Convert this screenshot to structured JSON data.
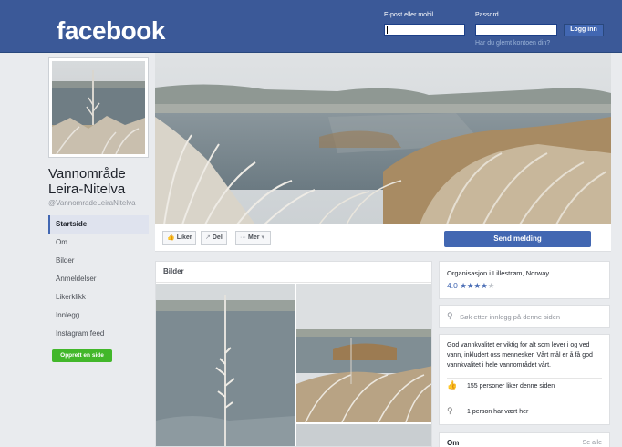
{
  "header": {
    "logo": "facebook",
    "email_label": "E-post eller mobil",
    "password_label": "Passord",
    "login_button": "Logg inn",
    "forgot_link": "Har du glemt kontoen din?",
    "brand_color": "#3b5998"
  },
  "page": {
    "name_line1": "Vannområde",
    "name_line2": "Leira-Nitelva",
    "handle": "@VannomradeLeiraNitelva"
  },
  "nav": {
    "items": [
      {
        "label": "Startside",
        "active": true
      },
      {
        "label": "Om",
        "active": false
      },
      {
        "label": "Bilder",
        "active": false
      },
      {
        "label": "Anmeldelser",
        "active": false
      },
      {
        "label": "Likerklikk",
        "active": false
      },
      {
        "label": "Innlegg",
        "active": false
      },
      {
        "label": "Instagram feed",
        "active": false
      }
    ],
    "create_page_button": "Opprett en side"
  },
  "actions": {
    "like": "Liker",
    "share": "Del",
    "more": "Mer",
    "send_message": "Send melding"
  },
  "photos": {
    "title": "Bilder"
  },
  "sidebar": {
    "org": "Organisasjon i Lillestrøm, Norway",
    "rating_value": "4.0",
    "rating_stars": 4,
    "rating_max": 5,
    "search_placeholder": "Søk etter innlegg på denne siden",
    "about": "God vannkvalitet er viktig for alt som lever i og ved vann, inkludert oss mennesker. Vårt mål er å få god vannkvalitet i hele vannområdet vårt.",
    "likes": "155 personer liker denne siden",
    "checkins": "1 person har vært her",
    "om_title": "Om",
    "see_all": "Se alle"
  }
}
